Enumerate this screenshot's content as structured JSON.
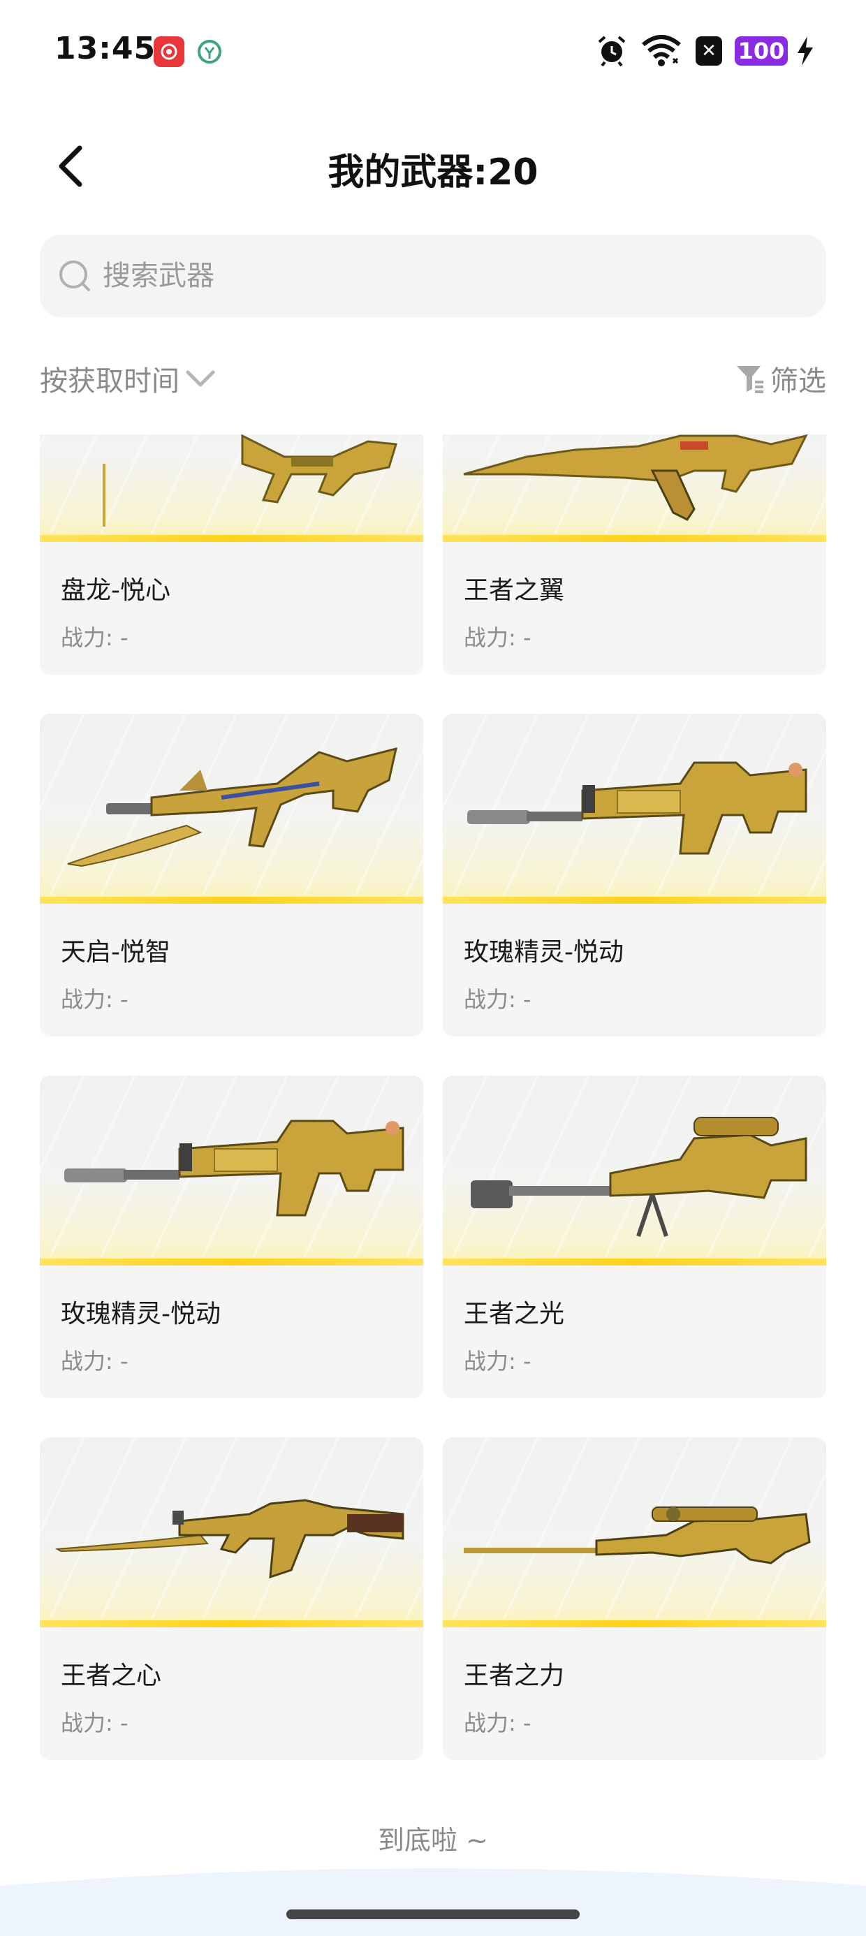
{
  "status_bar": {
    "time": "13:45",
    "battery": "100",
    "icons": [
      "netease-music-icon",
      "app-badge-icon",
      "alarm-icon",
      "wifi-icon",
      "close-box-icon",
      "battery-icon",
      "charging-icon"
    ]
  },
  "header": {
    "title": "我的武器:20",
    "back_icon": "chevron-left-icon"
  },
  "search": {
    "placeholder": "搜索武器",
    "value": ""
  },
  "toolbar": {
    "sort_label": "按获取时间",
    "filter_label": "筛选"
  },
  "weapons": [
    {
      "name": "盘龙-悦心",
      "power": "战力: -"
    },
    {
      "name": "王者之翼",
      "power": "战力: -"
    },
    {
      "name": "天启-悦智",
      "power": "战力: -"
    },
    {
      "name": "玫瑰精灵-悦动",
      "power": "战力: -"
    },
    {
      "name": "玫瑰精灵-悦动",
      "power": "战力: -"
    },
    {
      "name": "王者之光",
      "power": "战力: -"
    },
    {
      "name": "王者之心",
      "power": "战力: -"
    },
    {
      "name": "王者之力",
      "power": "战力: -"
    }
  ],
  "footer": {
    "end_text": "到底啦 ~"
  },
  "colors": {
    "accent_gold": "#ffd21a",
    "battery_purple": "#8a2be2",
    "card_bg": "#f5f5f5",
    "muted_text": "#8a8a8a"
  }
}
